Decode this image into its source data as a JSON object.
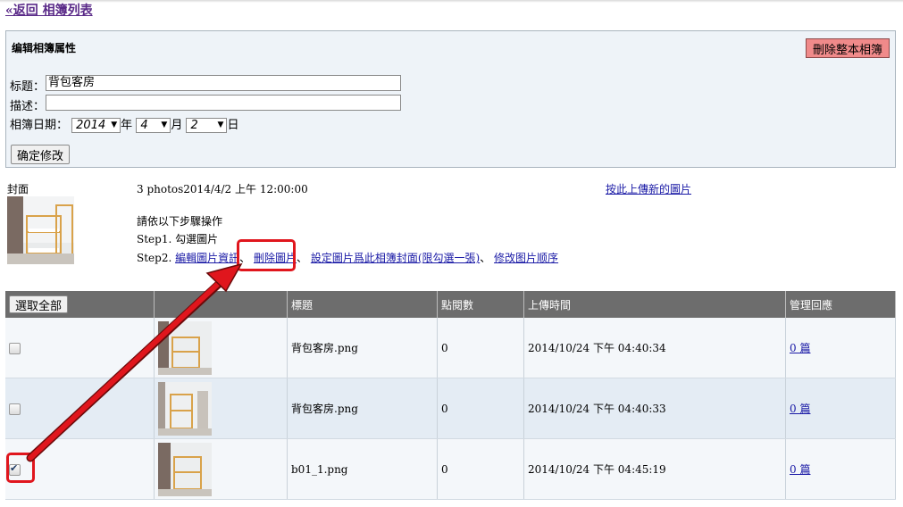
{
  "nav": {
    "back_label": "«返回 相簿列表"
  },
  "props": {
    "title": "编辑相簿属性",
    "delete_album_label": "刪除整本相簿",
    "title_label": "标题：",
    "title_value": "背包客房",
    "desc_label": "描述：",
    "desc_value": "",
    "date_label": "相簿日期：",
    "year": "2014",
    "year_unit": "年",
    "month": "4",
    "month_unit": "月",
    "day": "2",
    "day_unit": "日",
    "confirm_label": "确定修改"
  },
  "album": {
    "cover_label": "封面",
    "meta": "3 photos2014/4/2 上午 12:00:00",
    "upload_link": "按此上傳新的圖片",
    "instruction": "請依以下步驟操作",
    "step1": "Step1. 勾選圖片",
    "step2_prefix": "Step2.",
    "action_edit": "編輯圖片資訊",
    "action_delete": "刪除圖片",
    "action_set_cover": "設定圖片爲此相簿封面(限勾選一張)",
    "action_reorder": "修改图片顺序",
    "sep": "、"
  },
  "table": {
    "select_all_label": "選取全部",
    "headers": [
      "標題",
      "點閱數",
      "上傳時間",
      "管理回應"
    ],
    "rows": [
      {
        "checked": false,
        "title": "背包客房.png",
        "views": "0",
        "time": "2014/10/24 下午 04:40:34",
        "replies": "0 篇"
      },
      {
        "checked": false,
        "title": "背包客房.png",
        "views": "0",
        "time": "2014/10/24 下午 04:40:33",
        "replies": "0 篇"
      },
      {
        "checked": true,
        "title": "b01_1.png",
        "views": "0",
        "time": "2014/10/24 下午 04:45:19",
        "replies": "0 篇"
      }
    ]
  },
  "colors": {
    "highlight": "#e0161d",
    "header_bg": "#6d6d6d",
    "delete_btn": "#f08a8a"
  },
  "icons": {
    "dropdown": "dropdown-arrow-icon",
    "check": "checkmark-icon"
  }
}
